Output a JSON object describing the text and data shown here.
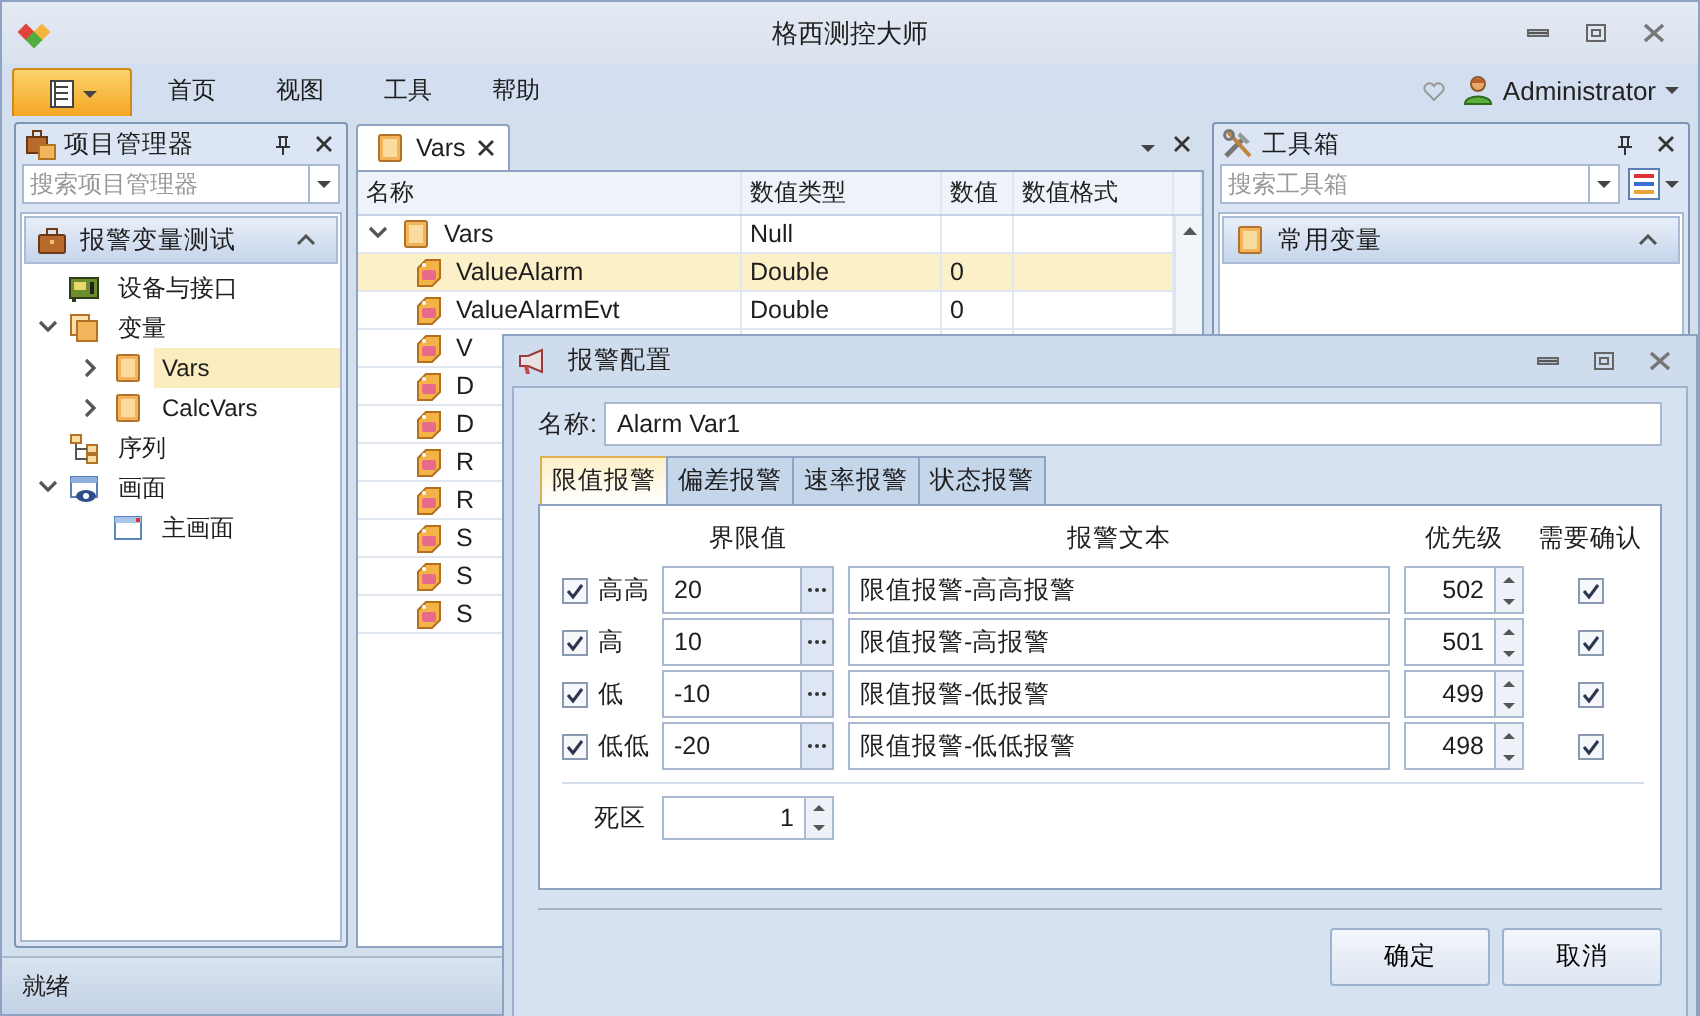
{
  "window": {
    "title": "格西测控大师"
  },
  "menu": {
    "items": [
      {
        "label": "首页"
      },
      {
        "label": "视图"
      },
      {
        "label": "工具"
      },
      {
        "label": "帮助"
      }
    ],
    "user": "Administrator"
  },
  "project_panel": {
    "title": "项目管理器",
    "search_placeholder": "搜索项目管理器",
    "group": {
      "label": "报警变量测试",
      "expanded": true
    },
    "tree": [
      {
        "label": "设备与接口",
        "kind": "device",
        "selected": false
      },
      {
        "label": "变量",
        "kind": "folder",
        "expanded": true,
        "selected": false,
        "children": [
          {
            "label": "Vars",
            "kind": "table",
            "expanded": false,
            "selected": true
          },
          {
            "label": "CalcVars",
            "kind": "table",
            "expanded": false,
            "selected": false
          }
        ]
      },
      {
        "label": "序列",
        "kind": "sequence",
        "selected": false
      },
      {
        "label": "画面",
        "kind": "screen",
        "expanded": true,
        "selected": false,
        "children": [
          {
            "label": "主画面",
            "kind": "page",
            "selected": false
          }
        ]
      }
    ]
  },
  "document": {
    "tabs": [
      {
        "label": "Vars",
        "selected": true
      }
    ],
    "columns": [
      "名称",
      "数值类型",
      "数值",
      "数值格式"
    ],
    "rows": [
      {
        "name": "Vars",
        "type": "Null",
        "kind": "table",
        "expanded": true,
        "selected": false,
        "children": [
          {
            "name": "ValueAlarm",
            "type": "Double",
            "value": "0",
            "kind": "alarm",
            "selected": true
          },
          {
            "name": "ValueAlarmEvt",
            "type": "Double",
            "value": "0",
            "kind": "alarm",
            "selected": false
          },
          {
            "name": "V",
            "kind": "alarm",
            "selected": false
          },
          {
            "name": "D",
            "kind": "alarm",
            "selected": false
          },
          {
            "name": "D",
            "kind": "alarm",
            "selected": false
          },
          {
            "name": "R",
            "kind": "alarm",
            "selected": false
          },
          {
            "name": "R",
            "kind": "alarm",
            "selected": false
          },
          {
            "name": "S",
            "kind": "alarm",
            "selected": false
          },
          {
            "name": "S",
            "kind": "alarm",
            "selected": false
          },
          {
            "name": "S",
            "kind": "alarm",
            "selected": false
          }
        ]
      }
    ]
  },
  "toolbox": {
    "title": "工具箱",
    "search_placeholder": "搜索工具箱",
    "group": {
      "label": "常用变量",
      "expanded": true
    }
  },
  "status_bar": {
    "text": "就绪"
  },
  "dialog": {
    "title": "报警配置",
    "name_label": "名称:",
    "name_value": "Alarm Var1",
    "tabs": [
      {
        "label": "限值报警",
        "selected": true
      },
      {
        "label": "偏差报警",
        "selected": false
      },
      {
        "label": "速率报警",
        "selected": false
      },
      {
        "label": "状态报警",
        "selected": false
      }
    ],
    "columns": [
      "界限值",
      "报警文本",
      "优先级",
      "需要确认"
    ],
    "limits": [
      {
        "enabled": true,
        "label": "高高",
        "limit": "20",
        "text": "限值报警-高高报警",
        "priority": "502",
        "confirm": true
      },
      {
        "enabled": true,
        "label": "高",
        "limit": "10",
        "text": "限值报警-高报警",
        "priority": "501",
        "confirm": true
      },
      {
        "enabled": true,
        "label": "低",
        "limit": "-10",
        "text": "限值报警-低报警",
        "priority": "499",
        "confirm": true
      },
      {
        "enabled": true,
        "label": "低低",
        "limit": "-20",
        "text": "限值报警-低低报警",
        "priority": "498",
        "confirm": true
      }
    ],
    "deadband": {
      "label": "死区",
      "value": "1"
    },
    "buttons": [
      "确定",
      "取消"
    ]
  }
}
